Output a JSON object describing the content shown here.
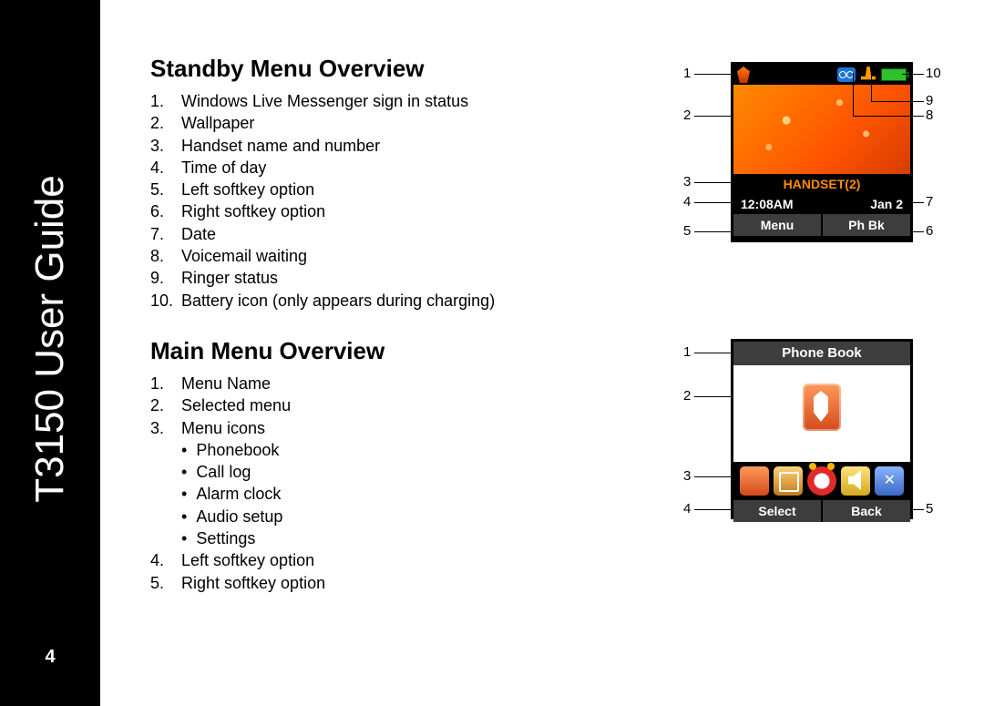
{
  "spine": {
    "title": "T3150 User Guide",
    "page": "4"
  },
  "standby": {
    "heading": "Standby Menu Overview",
    "items": [
      "Windows Live Messenger sign in status",
      "Wallpaper",
      "Handset name and number",
      "Time of day",
      "Left softkey option",
      "Right softkey option",
      "Date",
      "Voicemail waiting",
      "Ringer status",
      "Battery icon (only appears during charging)"
    ],
    "screen": {
      "handset": "HANDSET(2)",
      "time": "12:08AM",
      "date": "Jan 2",
      "left_soft": "Menu",
      "right_soft": "Ph Bk"
    },
    "labels": {
      "l1": "1",
      "l2": "2",
      "l3": "3",
      "l4": "4",
      "l5": "5",
      "l6": "6",
      "l7": "7",
      "l8": "8",
      "l9": "9",
      "l10": "10"
    }
  },
  "main": {
    "heading": "Main Menu Overview",
    "items": [
      {
        "n": "1.",
        "t": "Menu Name"
      },
      {
        "n": "2.",
        "t": "Selected menu"
      },
      {
        "n": "3.",
        "t": "Menu icons"
      }
    ],
    "icons": [
      "Phonebook",
      "Call log",
      "Alarm clock",
      "Audio setup",
      "Settings"
    ],
    "items2": [
      {
        "n": "4.",
        "t": "Left softkey option"
      },
      {
        "n": "5.",
        "t": "Right softkey option"
      }
    ],
    "screen": {
      "title": "Phone Book",
      "left_soft": "Select",
      "right_soft": "Back"
    },
    "labels": {
      "l1": "1",
      "l2": "2",
      "l3": "3",
      "l4": "4",
      "l5": "5"
    }
  }
}
